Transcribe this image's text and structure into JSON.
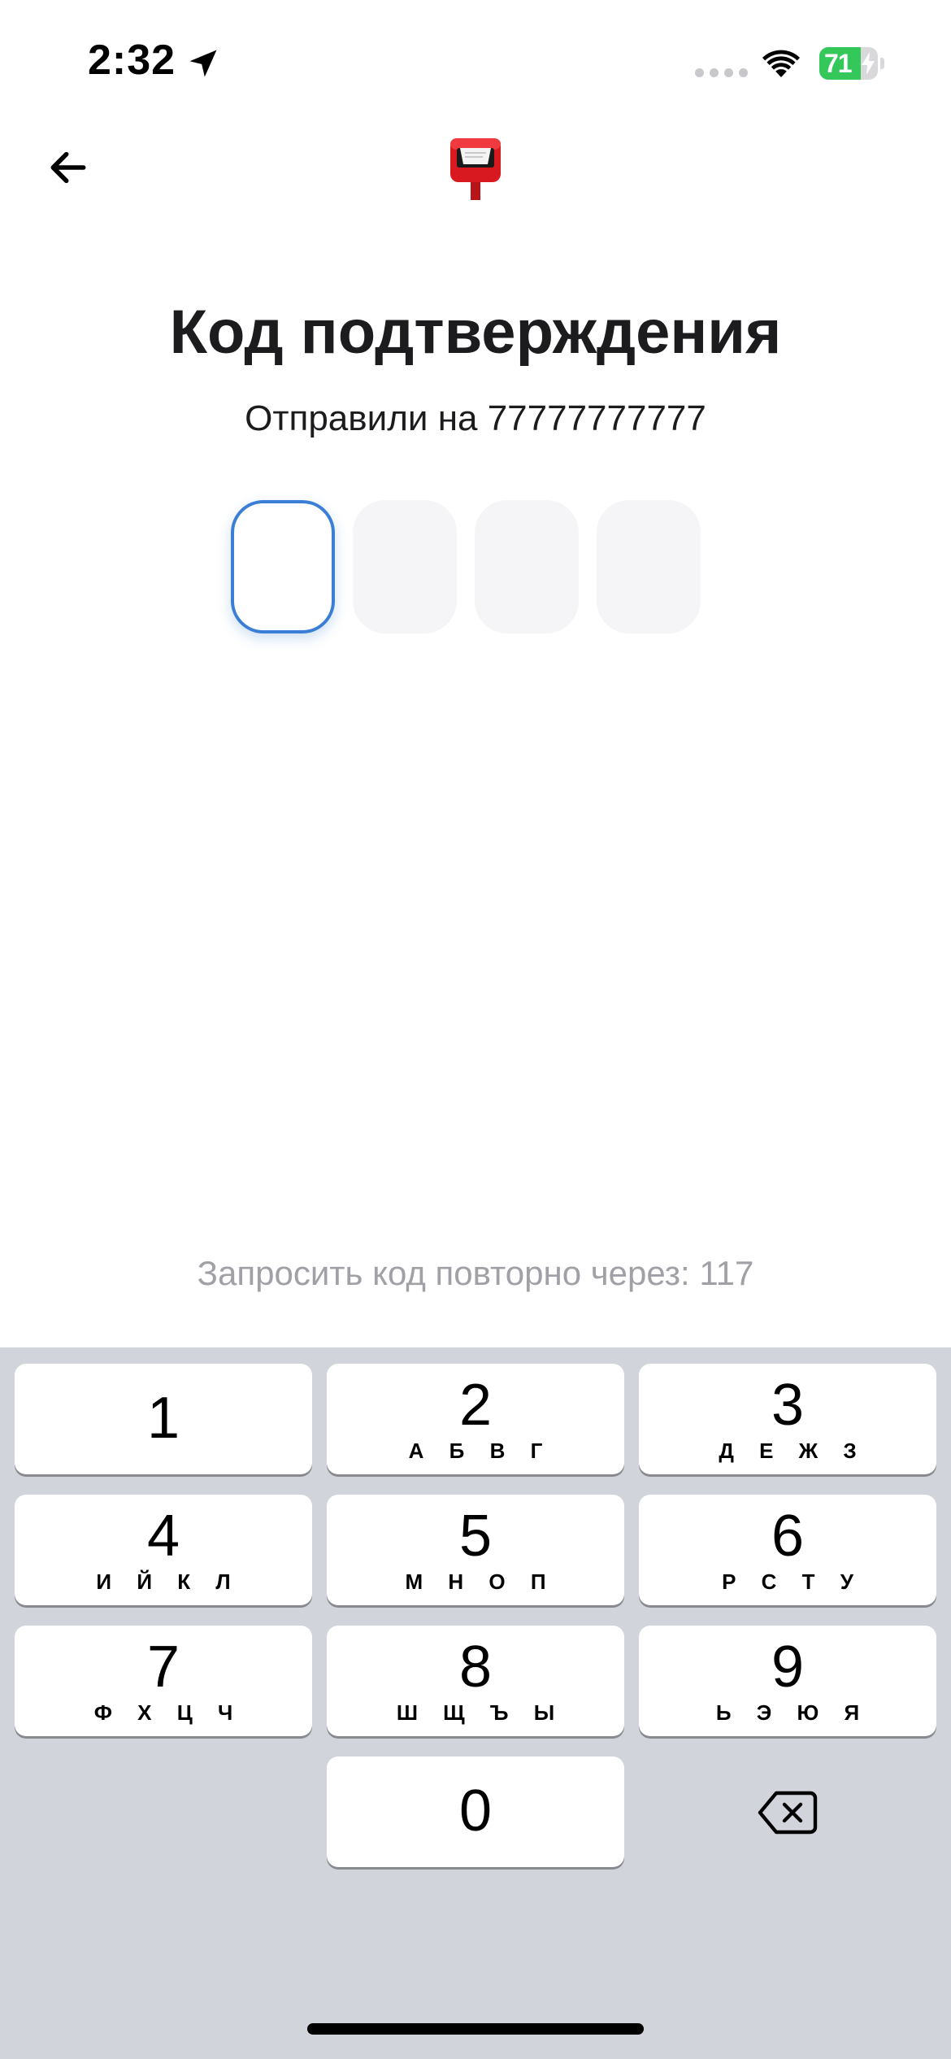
{
  "status_bar": {
    "time": "2:32",
    "battery_level": "71",
    "battery_percent": 71,
    "battery_charging": true,
    "location_icon": "location-arrow-icon",
    "wifi_icon": "wifi-icon"
  },
  "nav": {
    "back_icon": "arrow-left-icon",
    "logo_icon": "mailbox-icon"
  },
  "header": {
    "title": "Код подтверждения",
    "subtitle": "Отправили на 77777777777"
  },
  "code_input": {
    "length": 4,
    "values": [
      "",
      "",
      "",
      ""
    ],
    "active_index": 0
  },
  "resend": {
    "text": "Запросить код повторно через: 117"
  },
  "keyboard": {
    "keys": [
      {
        "digit": "1",
        "letters": ""
      },
      {
        "digit": "2",
        "letters": "А Б В Г"
      },
      {
        "digit": "3",
        "letters": "Д Е Ж З"
      },
      {
        "digit": "4",
        "letters": "И Й К Л"
      },
      {
        "digit": "5",
        "letters": "М Н О П"
      },
      {
        "digit": "6",
        "letters": "Р С Т У"
      },
      {
        "digit": "7",
        "letters": "Ф Х Ц Ч"
      },
      {
        "digit": "8",
        "letters": "Ш Щ Ъ Ы"
      },
      {
        "digit": "9",
        "letters": "Ь Э Ю Я"
      },
      {
        "digit": "0",
        "letters": ""
      }
    ],
    "backspace_icon": "backspace-icon"
  },
  "colors": {
    "accent": "#3a7fd5",
    "battery_green": "#34c759",
    "keyboard_bg": "#d1d4db",
    "muted_text": "#a0a0a6",
    "mailbox_red": "#d8191f"
  }
}
